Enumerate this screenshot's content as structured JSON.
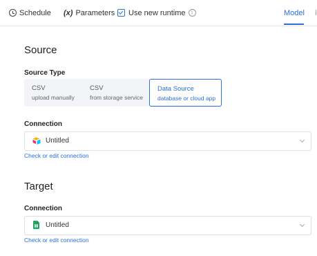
{
  "toolbar": {
    "schedule_label": "Schedule",
    "parameters_prefix": "(x)",
    "parameters_label": "Parameters",
    "runtime_label": "Use new runtime",
    "model_tab": "Model",
    "extra_tab": "I"
  },
  "source": {
    "title": "Source",
    "type_label": "Source Type",
    "options": [
      {
        "title": "CSV",
        "subtitle": "upload manually"
      },
      {
        "title": "CSV",
        "subtitle": "from storage service"
      },
      {
        "title": "Data Source",
        "subtitle": "database or cloud app"
      }
    ],
    "selected_option": "Data Source",
    "connection_label": "Connection",
    "connection_value": "Untitled",
    "connection_icon": "airtable-icon",
    "edit_link": "Check or edit connection"
  },
  "target": {
    "title": "Target",
    "connection_label": "Connection",
    "connection_value": "Untitled",
    "connection_icon": "google-sheets-icon",
    "edit_link": "Check or edit connection"
  },
  "colors": {
    "accent": "#2a6fdb",
    "segment_bg": "#f2f4f7",
    "border": "#dcdfe4"
  }
}
